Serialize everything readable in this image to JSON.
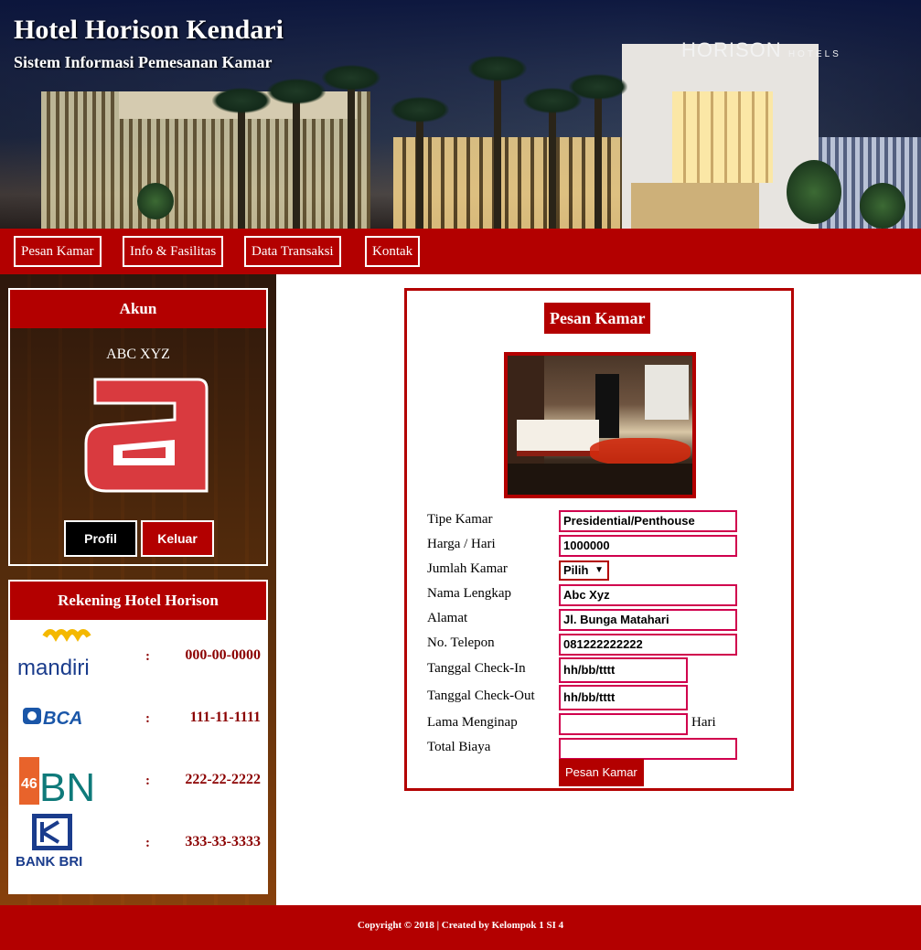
{
  "header": {
    "title": "Hotel Horison Kendari",
    "subtitle": "Sistem Informasi Pemesanan Kamar",
    "sign_main": "HORISON",
    "sign_sub": "HOTELS"
  },
  "nav": {
    "items": [
      "Pesan Kamar",
      "Info & Fasilitas",
      "Data Transaksi",
      "Kontak"
    ]
  },
  "account": {
    "heading": "Akun",
    "user_name": "ABC XYZ",
    "profile_button": "Profil",
    "logout_button": "Keluar"
  },
  "bank_accounts": {
    "heading": "Rekening Hotel Horison",
    "separator": ":",
    "items": [
      {
        "bank": "mandiri",
        "account": "000-00-0000"
      },
      {
        "bank": "BCA",
        "account": "111-11-1111"
      },
      {
        "bank": "BNI",
        "account": "222-22-2222"
      },
      {
        "bank": "BANK BRI",
        "account": "333-33-3333"
      }
    ]
  },
  "form": {
    "title": "Pesan Kamar",
    "labels": {
      "tipe_kamar": "Tipe Kamar",
      "harga": "Harga / Hari",
      "jumlah_kamar": "Jumlah Kamar",
      "nama": "Nama Lengkap",
      "alamat": "Alamat",
      "telepon": "No. Telepon",
      "checkin": "Tanggal Check-In",
      "checkout": "Tanggal Check-Out",
      "lama": "Lama Menginap",
      "total": "Total Biaya"
    },
    "values": {
      "tipe_kamar": "Presidential/Penthouse",
      "harga": "1000000",
      "jumlah_kamar": "Pilih",
      "nama": "Abc Xyz",
      "alamat": "Jl. Bunga Matahari",
      "telepon": "081222222222",
      "checkin": "hh/bb/tttt",
      "checkout": "hh/bb/tttt",
      "lama": "",
      "total": ""
    },
    "hari_label": "Hari",
    "submit": "Pesan Kamar"
  },
  "footer": {
    "text": "Copyright © 2018 | Created by Kelompok 1 SI 4"
  },
  "colors": {
    "brand_red": "#b30000",
    "input_border": "#d0004d"
  }
}
